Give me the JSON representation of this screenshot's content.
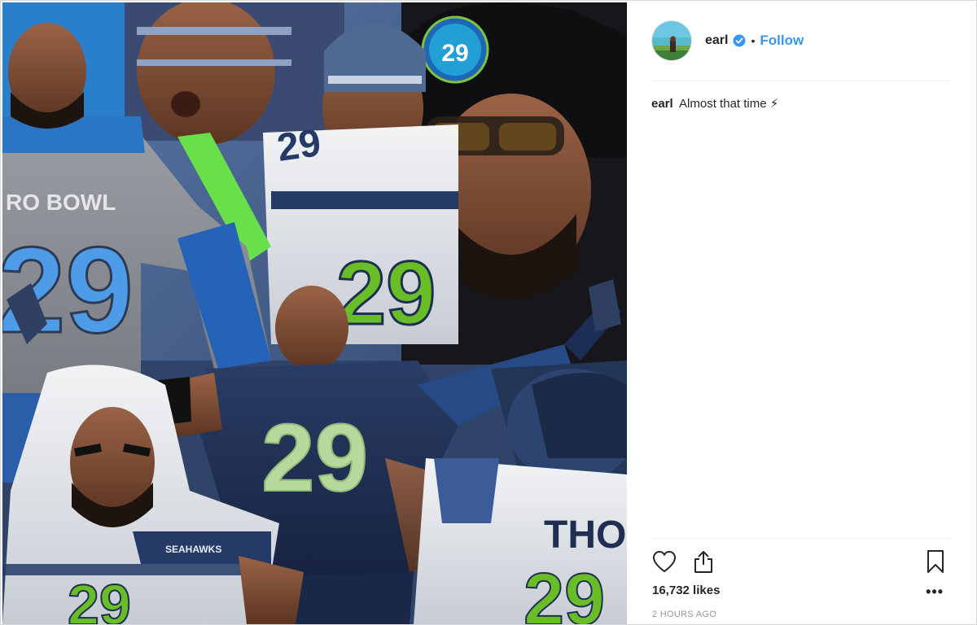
{
  "post": {
    "username": "earl",
    "separator": "•",
    "follow_label": "Follow",
    "caption_author": "earl",
    "caption_text": "Almost that time ⚡",
    "likes": "16,732 likes",
    "timestamp": "2 HOURS AGO",
    "more_label": "•••"
  },
  "media": {
    "jersey_number": "29",
    "shirt_text": "RO BOWL",
    "helmet_logo": "SEAHAWKS",
    "nameplate": "THOM",
    "hat_patch": "29"
  },
  "colors": {
    "accent": "#3897f0",
    "text": "#262626",
    "muted": "#999999",
    "navy": "#1e2f52",
    "action_green": "#69be28"
  },
  "icons": [
    "verified-badge-icon",
    "heart-icon",
    "share-icon",
    "bookmark-icon",
    "more-icon"
  ]
}
